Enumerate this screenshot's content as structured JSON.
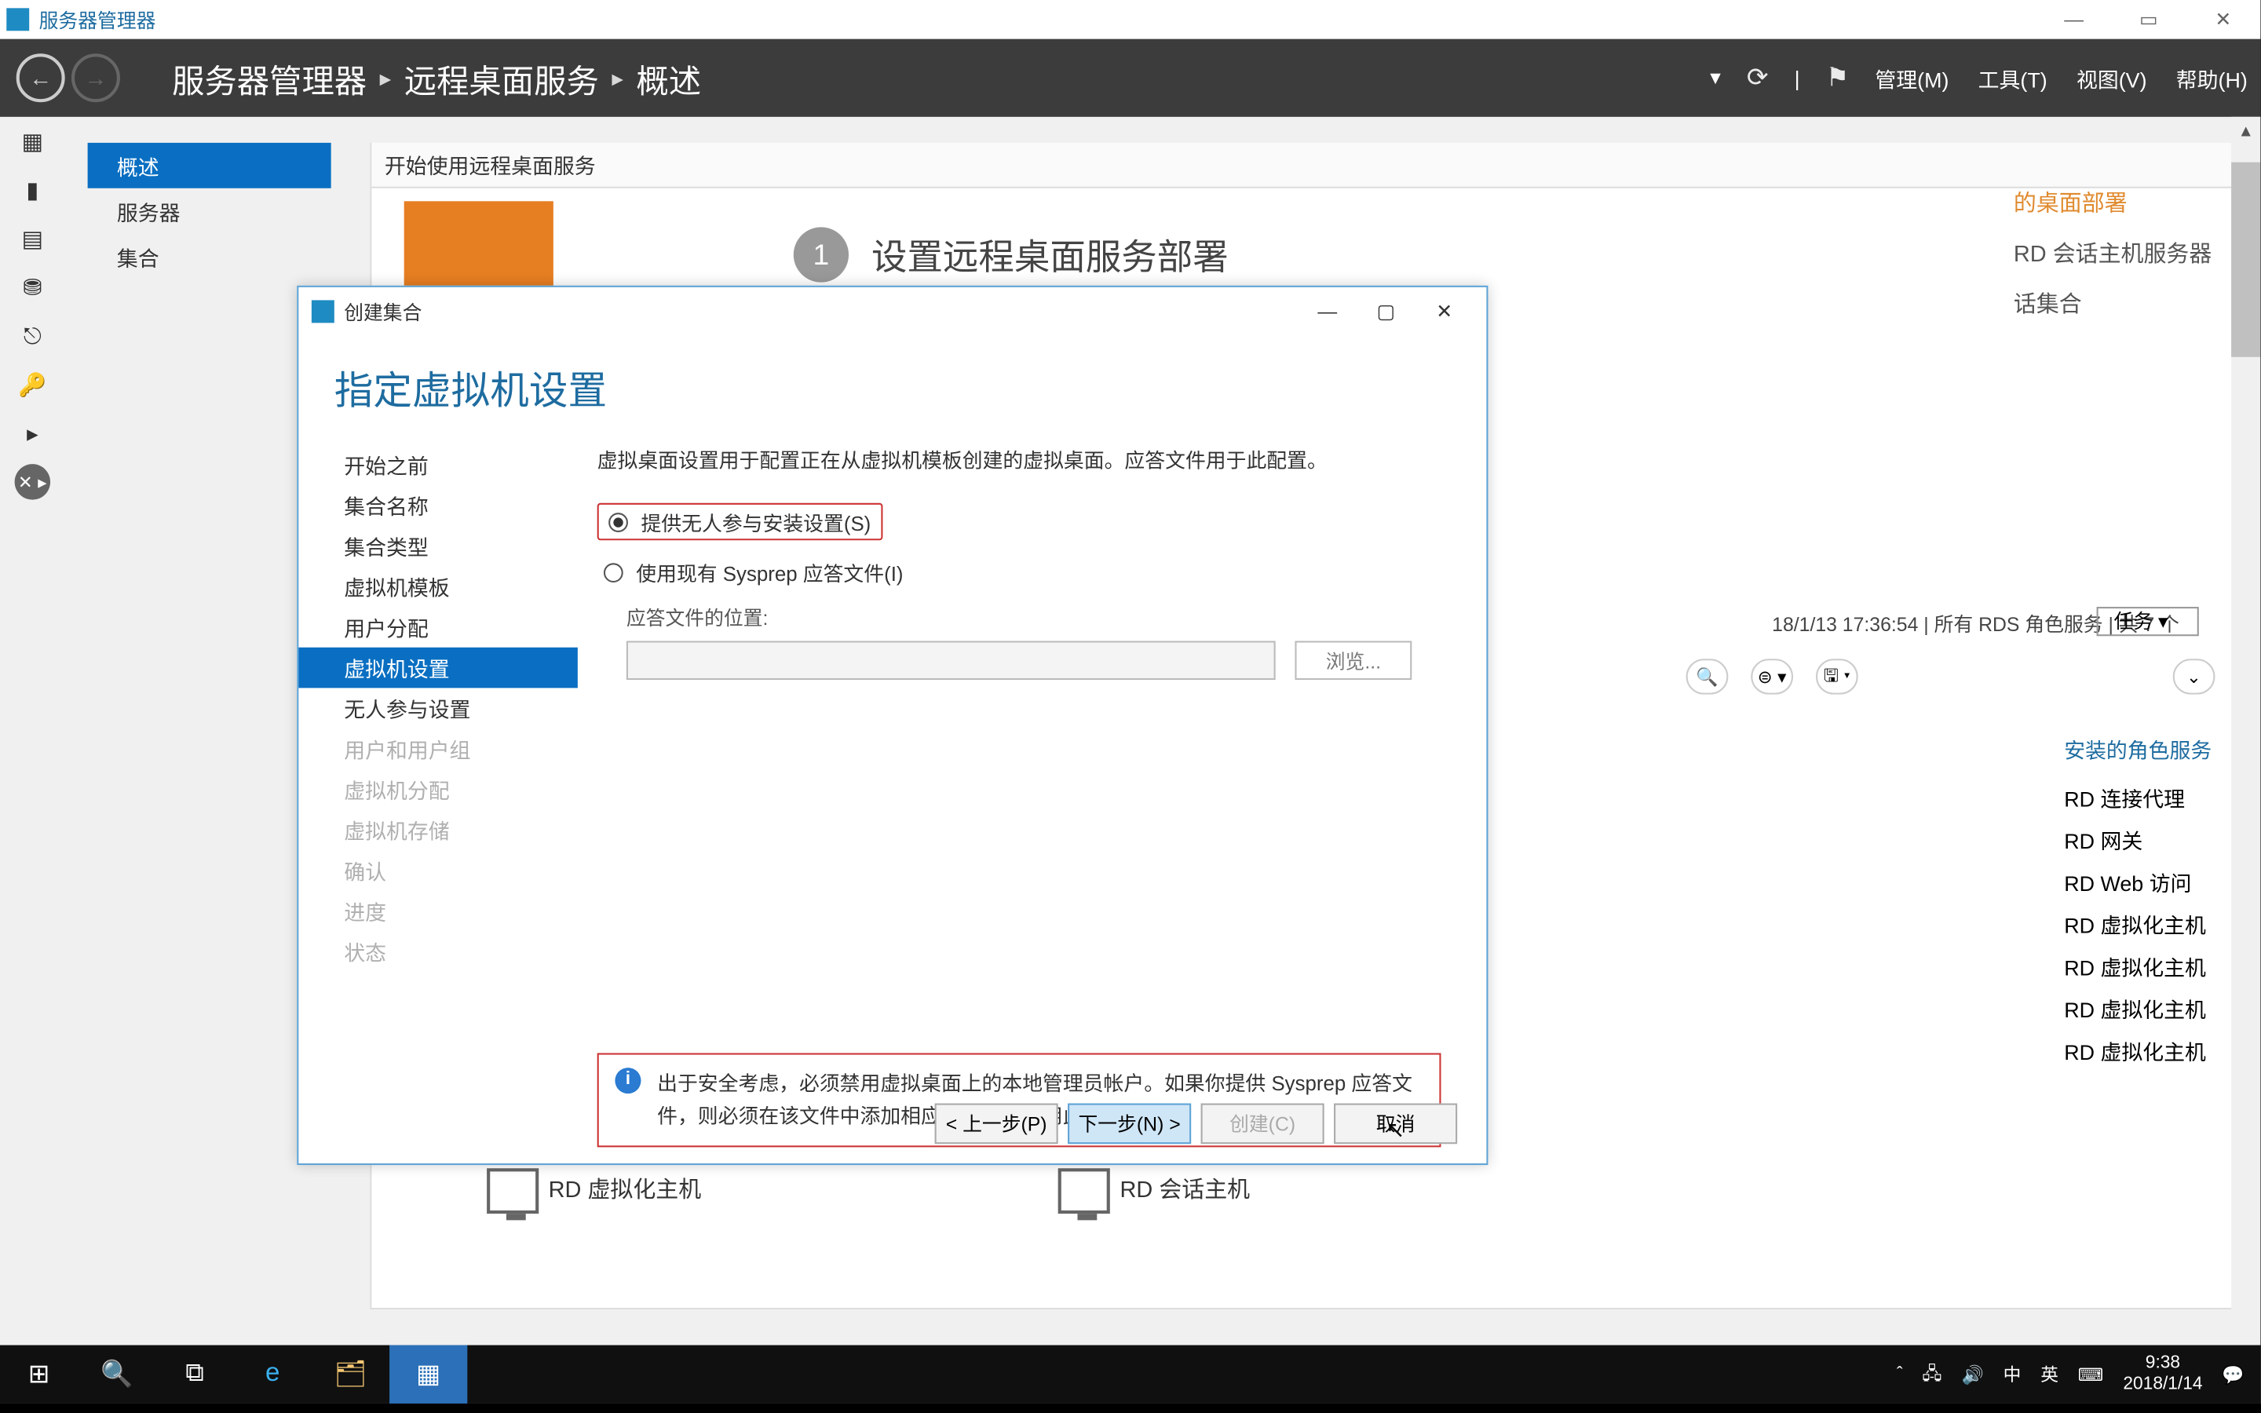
{
  "titlebar": {
    "title": "服务器管理器"
  },
  "header": {
    "crumbs": [
      "服务器管理器",
      "远程桌面服务",
      "概述"
    ],
    "menu": [
      "管理(M)",
      "工具(T)",
      "视图(V)",
      "帮助(H)"
    ]
  },
  "sidenav": {
    "items": [
      "概述",
      "服务器",
      "集合"
    ],
    "selected": 0
  },
  "main": {
    "heading": "开始使用远程桌面服务",
    "step_num": "1",
    "step_title": "设置远程桌面服务部署"
  },
  "bg": {
    "l1": "的桌面部署",
    "l2": "RD 会话主机服务器",
    "l3": "话集合",
    "meta": "18/1/13 17:36:54 | 所有 RDS 角色服务 | 共 7 个",
    "tasks": "任务",
    "roles_hdr": "安装的角色服务",
    "roles": [
      "RD 连接代理",
      "RD 网关",
      "RD Web 访问",
      "RD 虚拟化主机",
      "RD 虚拟化主机",
      "RD 虚拟化主机",
      "RD 虚拟化主机"
    ]
  },
  "hosts": {
    "left": "RD 虚拟化主机",
    "right": "RD 会话主机"
  },
  "wizard": {
    "title": "创建集合",
    "heading": "指定虚拟机设置",
    "steps": [
      "开始之前",
      "集合名称",
      "集合类型",
      "虚拟机模板",
      "用户分配",
      "虚拟机设置",
      "无人参与设置",
      "用户和用户组",
      "虚拟机分配",
      "虚拟机存储",
      "确认",
      "进度",
      "状态"
    ],
    "selected": 5,
    "dim_from": 7,
    "desc": "虚拟桌面设置用于配置正在从虚拟机模板创建的虚拟桌面。应答文件用于此配置。",
    "radio1": "提供无人参与安装设置(S)",
    "radio2": "使用现有 Sysprep 应答文件(I)",
    "answer_label": "应答文件的位置:",
    "browse": "浏览...",
    "info": "出于安全考虑，必须禁用虚拟桌面上的本地管理员帐户。如果你提供 Sysprep 应答文件，则必须在该文件中添加相应的条目以禁用此帐户。",
    "buttons": {
      "prev": "< 上一步(P)",
      "next": "下一步(N) >",
      "create": "创建(C)",
      "cancel": "取消"
    }
  },
  "tray": {
    "ime1": "中",
    "ime2": "英",
    "time": "9:38",
    "date": "2018/1/14"
  }
}
